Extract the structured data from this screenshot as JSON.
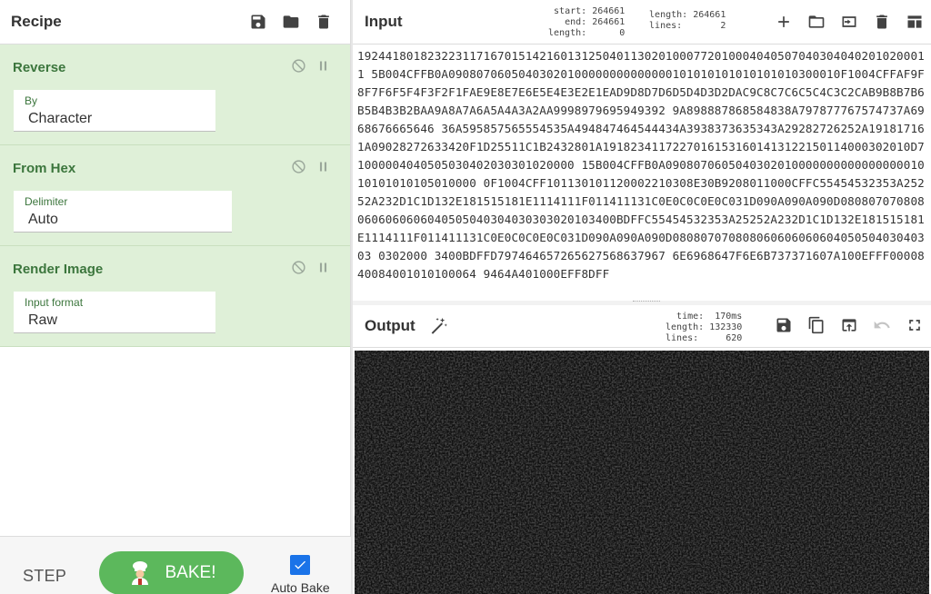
{
  "recipe": {
    "title": "Recipe",
    "operations": [
      {
        "name": "Reverse",
        "field_label": "By",
        "field_value": "Character"
      },
      {
        "name": "From Hex",
        "field_label": "Delimiter",
        "field_value": "Auto"
      },
      {
        "name": "Render Image",
        "field_label": "Input format",
        "field_value": "Raw"
      }
    ],
    "step_label": "STEP",
    "bake_label": "BAKE!",
    "auto_bake_label": "Auto Bake",
    "auto_bake_checked": true
  },
  "input": {
    "title": "Input",
    "start_label": "start:",
    "start": "264661",
    "end_label": "end:",
    "end": "264661",
    "length_label": "length:",
    "length": "0",
    "total_length_label": "length:",
    "total_length": "264661",
    "lines_label": "lines:",
    "lines": "2",
    "text": "1924418018232231171670151421601312504011302010007720100040405070403040402010200011 5B004CFFB0A09080706050403020100000000000000101010101010101010300010F1004CFFAF9F8F7F6F5F4F3F2F1FAE9E8E7E6E5E4E3E2E1EAD9D8D7D6D5D4D3D2DAC9C8C7C6C5C4C3C2CAB9B8B7B6B5B4B3B2BAA9A8A7A6A5A4A3A2AA9998979695949392 9A898887868584838A797877767574737A6968676665646 36A595857565554535A494847464544434A3938373635343A29282726252A191817161A09028272633420F1D25511C1B2432801A19182341172270161531601413122150114000302010D71000004040505030402030301020000 15B004CFFB0A090807060504030201000000000000000001010101010105010000 0F1004CFF101130101120002210308E30B9208011000CFFC55454532353A25252A232D1C1D132E181515181E1114111F011411131C0E0C0C0E0C031D090A090A090D0808070708080606060606040505040304030303020103400BDFFC55454532353A25252A232D1C1D132E181515181E1114111F011411131C0E0C0C0E0C031D090A090A090D08080707080806060606060405050403040303 0302000 3400BDFFD797464657265627568637967 6E6968647F6E6B737371607A100EFFF0000840084001010100064 9464A401000EFF8DFF"
  },
  "output": {
    "title": "Output",
    "time_label": "time:",
    "time": "170ms",
    "length_label": "length:",
    "length": "132330",
    "lines_label": "lines:",
    "lines": "620"
  },
  "colors": {
    "op_bg": "#dff0d8",
    "op_text": "#3c763d",
    "bake_green": "#5cb85c",
    "checkbox_blue": "#1a73e8",
    "output_bg": "#0f0f0f"
  },
  "icons": {
    "recipe": [
      "save-icon",
      "folder-icon",
      "trash-icon"
    ],
    "op_controls": [
      "disable-icon",
      "pause-icon"
    ],
    "input": [
      "plus-icon",
      "folder-icon",
      "input-to-output-icon",
      "trash-icon",
      "layout-icon"
    ],
    "output": [
      "magic-wand-icon",
      "save-icon",
      "copy-icon",
      "open-new-tab-icon",
      "undo-icon",
      "fullscreen-icon"
    ]
  }
}
